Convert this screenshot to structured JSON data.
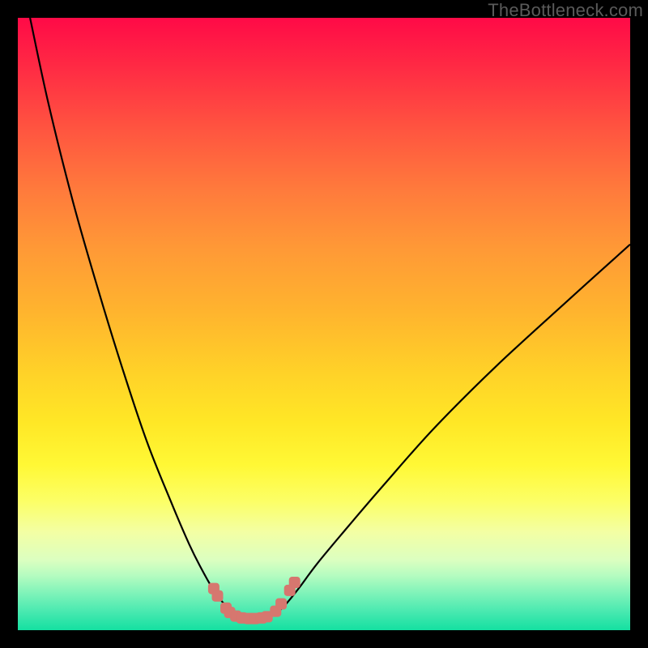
{
  "watermark": {
    "text": "TheBottleneck.com"
  },
  "chart_data": {
    "type": "line",
    "title": "",
    "xlabel": "",
    "ylabel": "",
    "xlim": [
      0,
      100
    ],
    "ylim": [
      0,
      100
    ],
    "series": [
      {
        "name": "left-curve",
        "x": [
          2,
          5,
          9,
          13,
          17,
          21,
          25,
          28,
          30,
          32,
          33.5,
          35,
          36
        ],
        "y": [
          100,
          86,
          70,
          56,
          43,
          31,
          21,
          14,
          10,
          6.5,
          4.5,
          3,
          2.2
        ]
      },
      {
        "name": "right-curve",
        "x": [
          41,
          42.5,
          44,
          46,
          49,
          54,
          60,
          68,
          78,
          90,
          100
        ],
        "y": [
          2.2,
          3,
          4.5,
          7,
          11,
          17,
          24,
          33,
          43,
          54,
          63
        ]
      },
      {
        "name": "valley-floor",
        "x": [
          36,
          37,
          38.5,
          40,
          41
        ],
        "y": [
          2.2,
          2.0,
          1.9,
          2.0,
          2.2
        ]
      }
    ],
    "markers": {
      "left": [
        {
          "x": 32.0,
          "y": 6.8
        },
        {
          "x": 32.6,
          "y": 5.6
        },
        {
          "x": 34.0,
          "y": 3.6
        },
        {
          "x": 34.6,
          "y": 2.9
        },
        {
          "x": 35.6,
          "y": 2.3
        },
        {
          "x": 36.6,
          "y": 2.0
        },
        {
          "x": 37.7,
          "y": 1.9
        },
        {
          "x": 38.7,
          "y": 1.9
        },
        {
          "x": 39.8,
          "y": 2.0
        },
        {
          "x": 40.7,
          "y": 2.2
        }
      ],
      "right": [
        {
          "x": 42.1,
          "y": 3.1
        },
        {
          "x": 43.0,
          "y": 4.3
        },
        {
          "x": 44.4,
          "y": 6.5
        },
        {
          "x": 45.2,
          "y": 7.8
        }
      ]
    },
    "colors": {
      "curve": "#000000",
      "marker_fill": "#d6776f",
      "marker_stroke": "#d6776f"
    }
  }
}
